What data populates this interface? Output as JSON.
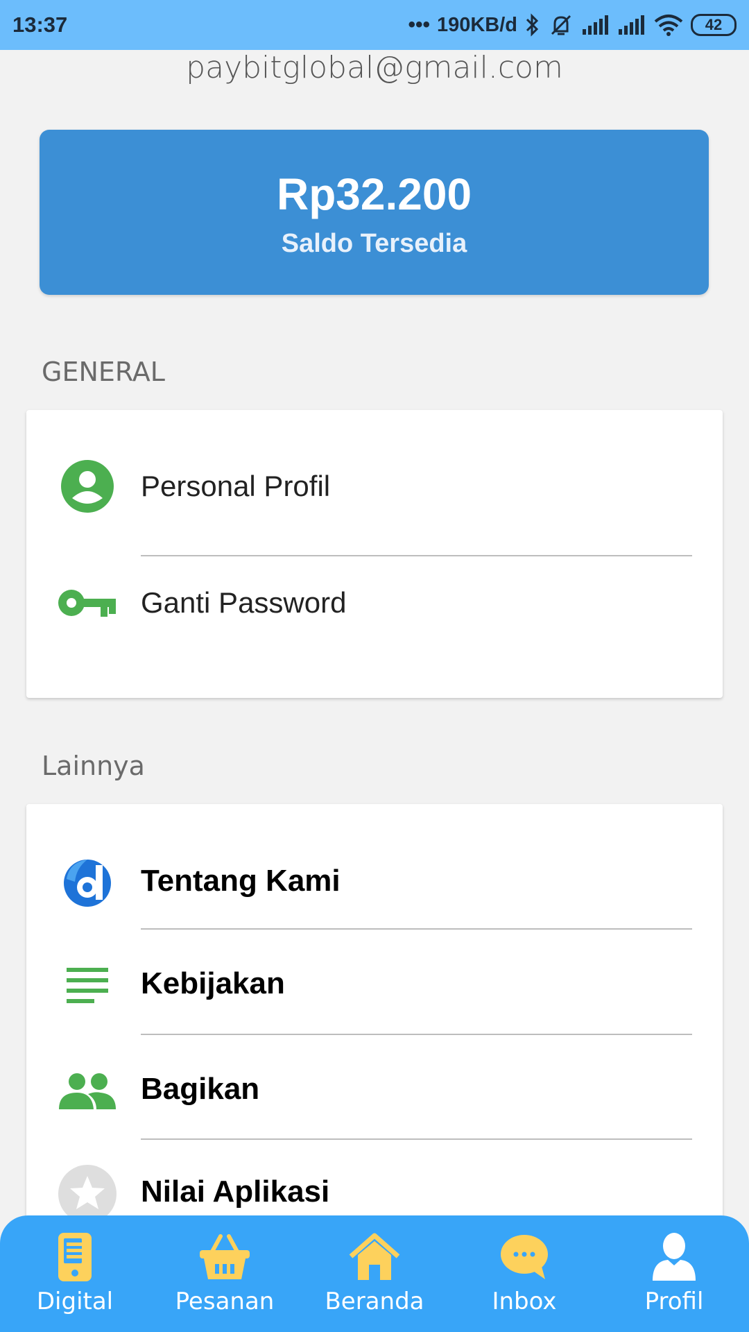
{
  "status_bar": {
    "time": "13:37",
    "speed": "190KB/d",
    "battery": "42"
  },
  "account": {
    "email": "paybitglobal@gmail.com"
  },
  "balance": {
    "amount": "Rp32.200",
    "label": "Saldo Tersedia"
  },
  "sections": {
    "general": {
      "title": "GENERAL",
      "items": [
        {
          "label": "Personal Profil",
          "icon": "person-circle-icon"
        },
        {
          "label": "Ganti Password",
          "icon": "key-icon"
        }
      ]
    },
    "others": {
      "title": "Lainnya",
      "items": [
        {
          "label": "Tentang Kami",
          "icon": "app-logo-icon"
        },
        {
          "label": "Kebijakan",
          "icon": "notes-icon"
        },
        {
          "label": "Bagikan",
          "icon": "people-icon"
        },
        {
          "label": "Nilai Aplikasi",
          "icon": "star-icon"
        }
      ]
    }
  },
  "bottom_nav": {
    "items": [
      {
        "label": "Digital",
        "icon": "phone-icon"
      },
      {
        "label": "Pesanan",
        "icon": "basket-icon"
      },
      {
        "label": "Beranda",
        "icon": "home-icon"
      },
      {
        "label": "Inbox",
        "icon": "chat-icon"
      },
      {
        "label": "Profil",
        "icon": "user-icon"
      }
    ]
  },
  "colors": {
    "status_bar": "#6cbdfc",
    "balance_card": "#3c8fd5",
    "icon_green": "#4caf50",
    "bottom_nav": "#38a5f8",
    "nav_icon": "#fdd15c"
  }
}
